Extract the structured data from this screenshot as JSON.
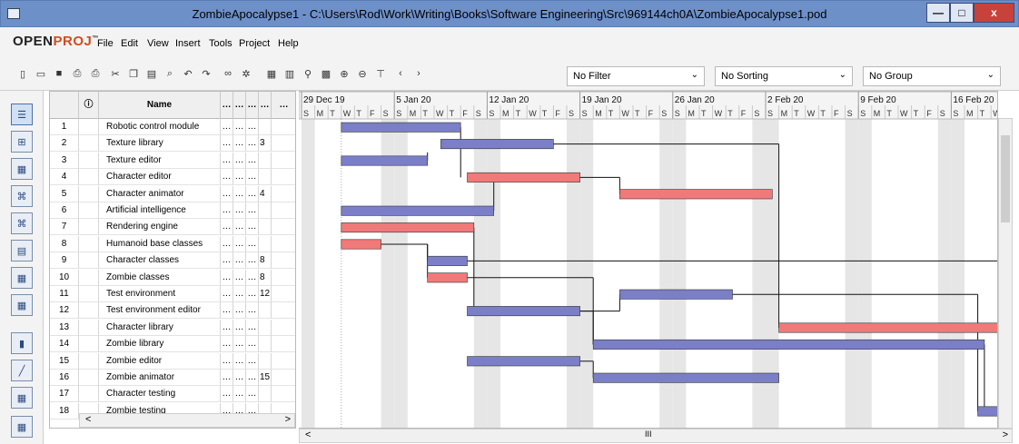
{
  "window": {
    "title": "ZombieApocalypse1 - C:\\Users\\Rod\\Work\\Writing\\Books\\Software Engineering\\Src\\969144ch0A\\ZombieApocalypse1.pod",
    "min_label": "—",
    "max_label": "□",
    "close_label": "x"
  },
  "app": {
    "logo_main": "OPEN",
    "logo_accent": "PROJ",
    "logo_tm": "™"
  },
  "menu": [
    "File",
    "Edit",
    "View",
    "Insert",
    "Tools",
    "Project",
    "Help"
  ],
  "toolbar": {
    "icons": [
      "new-icon",
      "open-icon",
      "save-icon",
      "print-icon",
      "print-preview-icon",
      "cut-icon",
      "copy-icon",
      "paste-icon",
      "find-icon",
      "undo-icon",
      "redo-icon",
      "link-icon",
      "unlink-icon",
      "task-info-icon",
      "notes-icon",
      "assign-resources-icon",
      "calendar-icon",
      "zoom-in-icon",
      "zoom-out-icon",
      "filter-icon",
      "scroll-left-icon",
      "scroll-right-icon"
    ],
    "filter": "No Filter",
    "sorting": "No Sorting",
    "group": "No Group"
  },
  "sidebar_views": [
    "gantt-view",
    "network-view",
    "resources-view",
    "wbs-view",
    "rbs-view",
    "project-view",
    "task-usage-view",
    "resource-usage-view",
    "histogram-view",
    "charts-view",
    "task-usage-detail-view",
    "resource-usage-detail-view"
  ],
  "grid": {
    "name_header": "Name",
    "rows": [
      {
        "id": "1",
        "name": "Robotic control module",
        "pred": ""
      },
      {
        "id": "2",
        "name": "Texture library",
        "pred": "3"
      },
      {
        "id": "3",
        "name": "Texture editor",
        "pred": ""
      },
      {
        "id": "4",
        "name": "Character editor",
        "pred": ""
      },
      {
        "id": "5",
        "name": "Character animator",
        "pred": "4"
      },
      {
        "id": "6",
        "name": "Artificial intelligence",
        "pred": ""
      },
      {
        "id": "7",
        "name": "Rendering engine",
        "pred": ""
      },
      {
        "id": "8",
        "name": "Humanoid base classes",
        "pred": ""
      },
      {
        "id": "9",
        "name": "Character classes",
        "pred": "8"
      },
      {
        "id": "10",
        "name": "Zombie classes",
        "pred": "8"
      },
      {
        "id": "11",
        "name": "Test environment",
        "pred": "12"
      },
      {
        "id": "12",
        "name": "Test environment editor",
        "pred": ""
      },
      {
        "id": "13",
        "name": "Character library",
        "pred": ""
      },
      {
        "id": "14",
        "name": "Zombie library",
        "pred": ""
      },
      {
        "id": "15",
        "name": "Zombie editor",
        "pred": ""
      },
      {
        "id": "16",
        "name": "Zombie animator",
        "pred": "15"
      },
      {
        "id": "17",
        "name": "Character testing",
        "pred": ""
      },
      {
        "id": "18",
        "name": "Zombie testing",
        "pred": ""
      }
    ]
  },
  "gantt": {
    "weeks": [
      "29 Dec 19",
      "5 Jan 20",
      "12 Jan 20",
      "19 Jan 20",
      "26 Jan 20",
      "2 Feb 20",
      "9 Feb 20",
      "16 Feb 20"
    ],
    "day_letters": [
      "S",
      "M",
      "T",
      "W",
      "T",
      "F",
      "S"
    ],
    "colors": {
      "normal": "#7b7fc8",
      "critical": "#f07a7a",
      "weekend": "#e6e6e6"
    },
    "bars": [
      {
        "row": 1,
        "start": 3,
        "end": 12,
        "critical": false
      },
      {
        "row": 2,
        "start": 10.5,
        "end": 19,
        "critical": false
      },
      {
        "row": 3,
        "start": 3,
        "end": 9.5,
        "critical": false
      },
      {
        "row": 4,
        "start": 12.5,
        "end": 21,
        "critical": true
      },
      {
        "row": 5,
        "start": 24,
        "end": 35.5,
        "critical": true
      },
      {
        "row": 6,
        "start": 3,
        "end": 14.5,
        "critical": false
      },
      {
        "row": 7,
        "start": 3,
        "end": 13,
        "critical": true
      },
      {
        "row": 8,
        "start": 3,
        "end": 6,
        "critical": true
      },
      {
        "row": 9,
        "start": 9.5,
        "end": 12.5,
        "critical": false
      },
      {
        "row": 10,
        "start": 9.5,
        "end": 12.5,
        "critical": true
      },
      {
        "row": 11,
        "start": 24,
        "end": 32.5,
        "critical": false
      },
      {
        "row": 12,
        "start": 12.5,
        "end": 21,
        "critical": false
      },
      {
        "row": 13,
        "start": 36,
        "end": 53,
        "critical": true
      },
      {
        "row": 14,
        "start": 22,
        "end": 51.5,
        "critical": false
      },
      {
        "row": 15,
        "start": 12.5,
        "end": 21,
        "critical": false
      },
      {
        "row": 16,
        "start": 22,
        "end": 36,
        "critical": false
      },
      {
        "row": 17,
        "start": 54,
        "end": 62.5,
        "critical": true
      },
      {
        "row": 18,
        "start": 51,
        "end": 55.5,
        "critical": false
      }
    ]
  },
  "scroll": {
    "left_arrow": "<",
    "right_arrow": ">",
    "grip": "III"
  }
}
